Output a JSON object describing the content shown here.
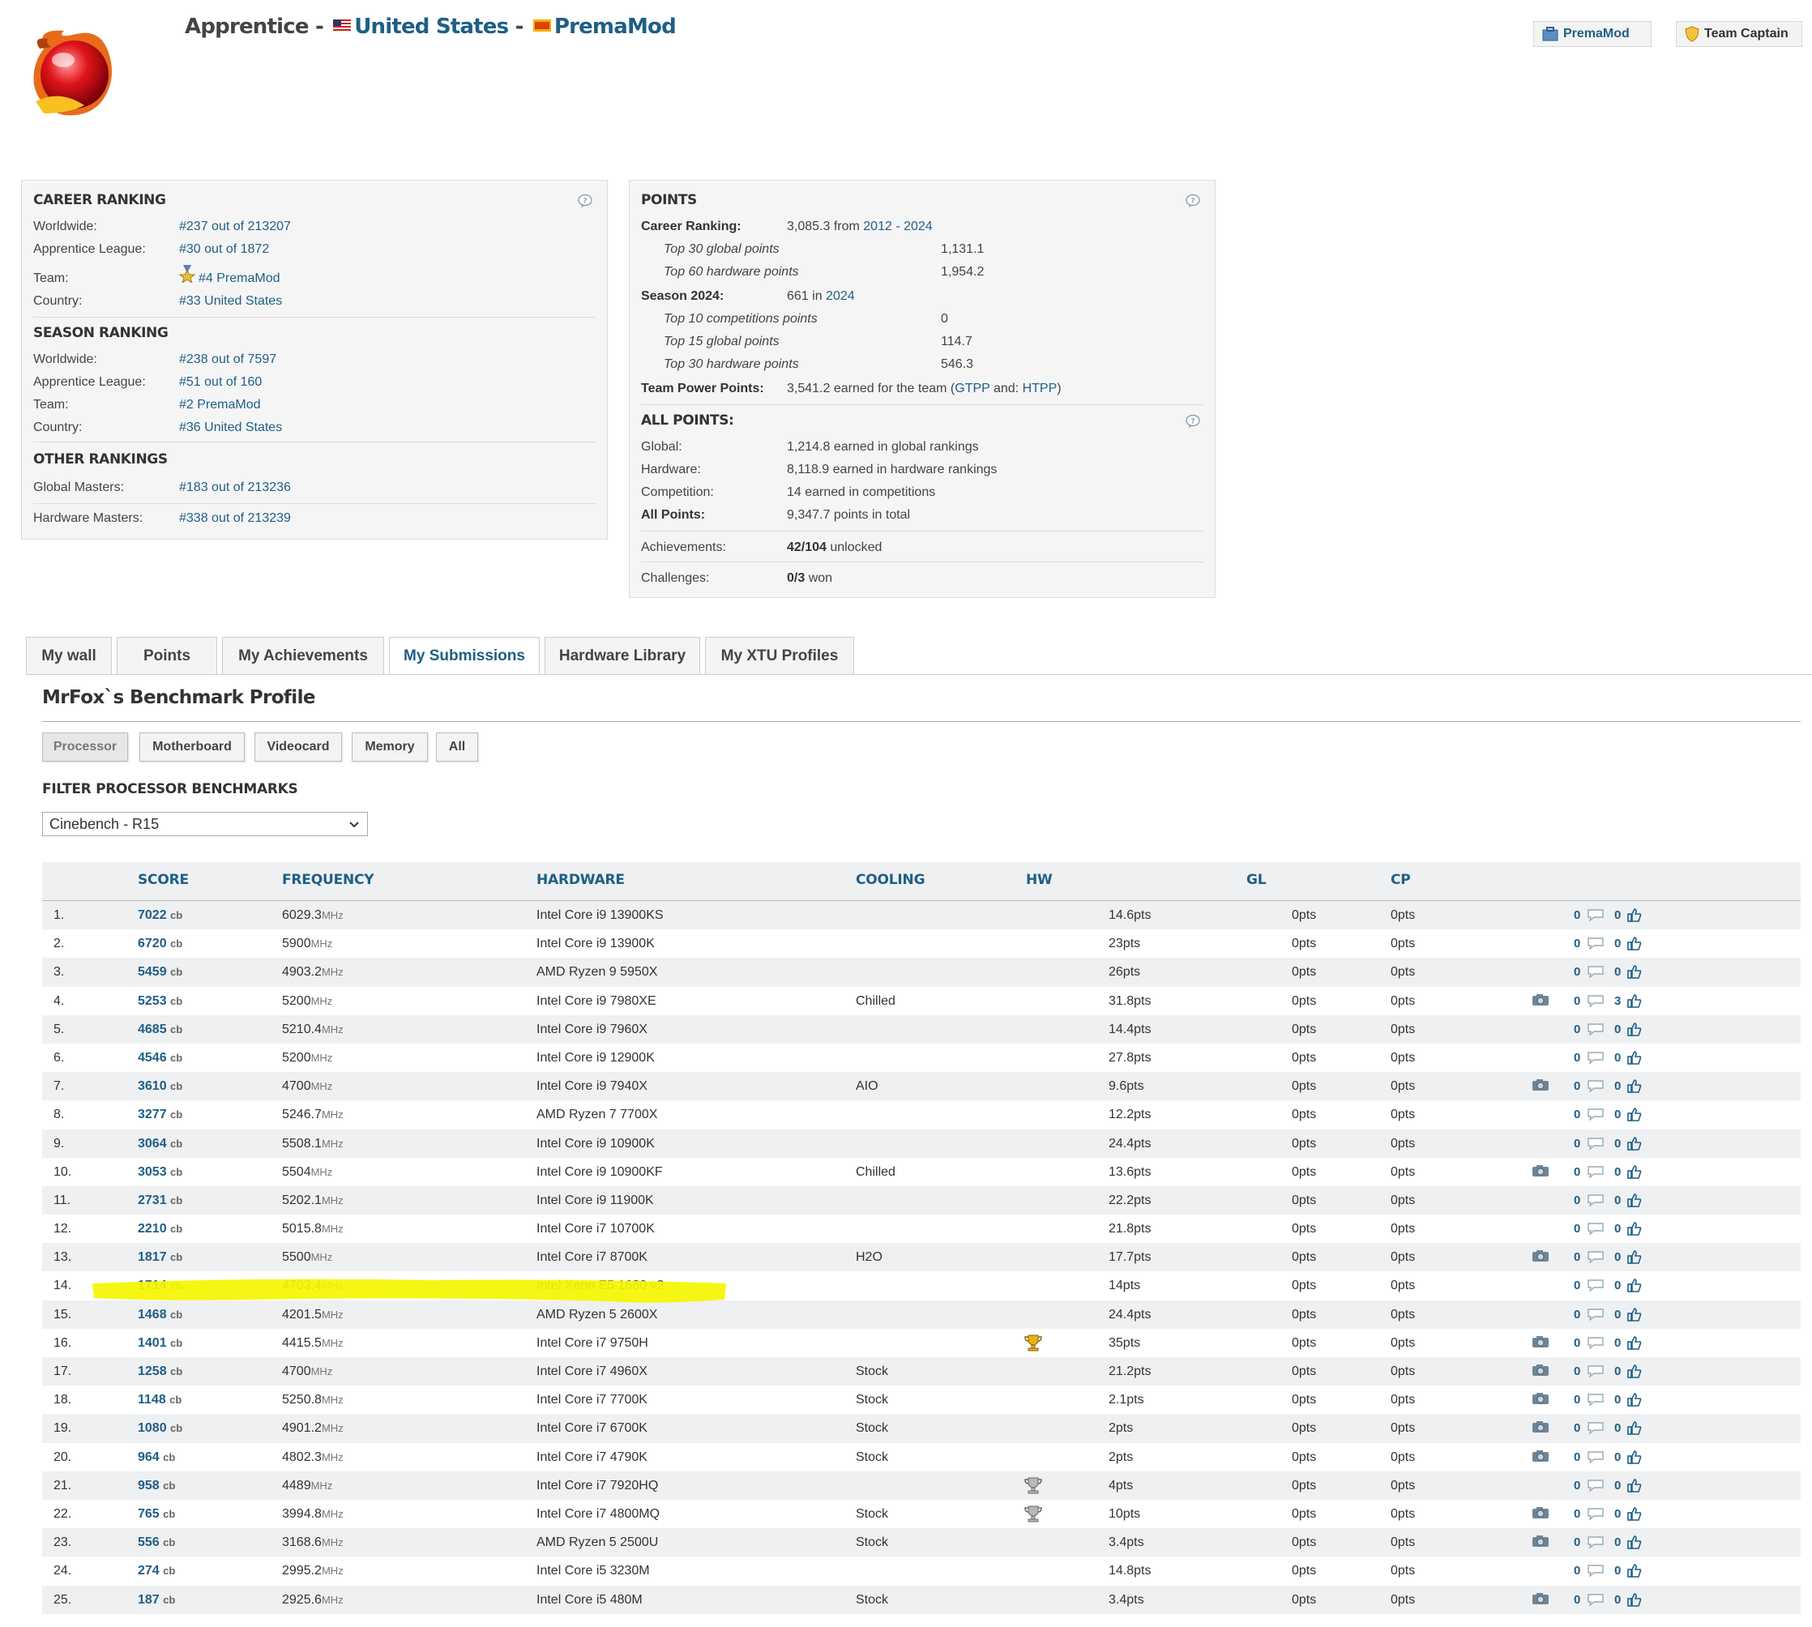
{
  "header": {
    "rank_title": "Apprentice",
    "country": "United States",
    "team": "PremaMod",
    "badge_team": "PremaMod",
    "badge_captain": "Team Captain",
    "separator": " - "
  },
  "career_ranking": {
    "title": "CAREER RANKING",
    "rows": [
      {
        "label": "Worldwide:",
        "value": "#237 out of 213207"
      },
      {
        "label": "Apprentice League:",
        "value": "#30 out of 1872"
      },
      {
        "label": "Team:",
        "value": "#4 PremaMod"
      },
      {
        "label": "Country:",
        "value": "#33 United States"
      }
    ]
  },
  "season_ranking": {
    "title": "SEASON RANKING",
    "rows": [
      {
        "label": "Worldwide:",
        "value": "#238 out of 7597"
      },
      {
        "label": "Apprentice League:",
        "value": "#51 out of 160"
      },
      {
        "label": "Team:",
        "value": "#2 PremaMod"
      },
      {
        "label": "Country:",
        "value": "#36 United States"
      }
    ]
  },
  "other_rankings": {
    "title": "OTHER RANKINGS",
    "rows": [
      {
        "label": "Global Masters:",
        "value": "#183 out of 213236"
      },
      {
        "label": "Hardware Masters:",
        "value": "#338 out of 213239"
      }
    ]
  },
  "points": {
    "title": "POINTS",
    "career_label": "Career Ranking:",
    "career_value": "3,085.3 from",
    "career_years": "2012 - 2024",
    "career_sub": [
      {
        "label": "Top 30 global points",
        "value": "1,131.1"
      },
      {
        "label": "Top 60 hardware points",
        "value": "1,954.2"
      }
    ],
    "season_label": "Season 2024:",
    "season_value": "661 in",
    "season_year": "2024",
    "season_sub": [
      {
        "label": "Top 10 competitions points",
        "value": "0"
      },
      {
        "label": "Top 15 global points",
        "value": "114.7"
      },
      {
        "label": "Top 30 hardware points",
        "value": "546.3"
      }
    ],
    "team_power_label": "Team Power Points:",
    "team_power_value": "3,541.2 earned for the team (",
    "gtpp": "GTPP",
    "and": " and: ",
    "htpp": "HTPP",
    "close": ")"
  },
  "all_points": {
    "title": "ALL POINTS:",
    "rows": [
      {
        "label": "Global:",
        "value": "1,214.8 earned in global rankings"
      },
      {
        "label": "Hardware:",
        "value": "8,118.9 earned in hardware rankings"
      },
      {
        "label": "Competition:",
        "value": "14 earned in competitions"
      }
    ],
    "total_label": "All Points:",
    "total_value": "9,347.7 points in total",
    "achievements_label": "Achievements:",
    "achievements_bold": "42/104",
    "achievements_rest": " unlocked",
    "challenges_label": "Challenges:",
    "challenges_bold": "0/3",
    "challenges_rest": " won"
  },
  "tabs": [
    "My wall",
    "Points",
    "My Achievements",
    "My Submissions",
    "Hardware Library",
    "My XTU Profiles"
  ],
  "active_tab": "My Submissions",
  "profile_title": "MrFox`s Benchmark Profile",
  "filter_tabs": [
    "Processor",
    "Motherboard",
    "Videocard",
    "Memory",
    "All"
  ],
  "active_filter_tab": "Processor",
  "filter_label": "FILTER PROCESSOR BENCHMARKS",
  "filter_value": "Cinebench - R15",
  "table": {
    "headers": {
      "score": "SCORE",
      "frequency": "FREQUENCY",
      "hardware": "HARDWARE",
      "cooling": "COOLING",
      "hw": "HW",
      "gl": "GL",
      "cp": "CP"
    },
    "score_unit": "cb",
    "freq_unit": "MHz",
    "rows": [
      {
        "rank": "1.",
        "score": "7022",
        "freq": "6029.3",
        "hw": "Intel Core i9 13900KS",
        "cooling": "",
        "trophy": "",
        "hwp": "14.6pts",
        "gl": "0pts",
        "cp": "0pts",
        "photo": false,
        "comments": "0",
        "likes": "0"
      },
      {
        "rank": "2.",
        "score": "6720",
        "freq": "5900",
        "hw": "Intel Core i9 13900K",
        "cooling": "",
        "trophy": "",
        "hwp": "23pts",
        "gl": "0pts",
        "cp": "0pts",
        "photo": false,
        "comments": "0",
        "likes": "0"
      },
      {
        "rank": "3.",
        "score": "5459",
        "freq": "4903.2",
        "hw": "AMD Ryzen 9 5950X",
        "cooling": "",
        "trophy": "",
        "hwp": "26pts",
        "gl": "0pts",
        "cp": "0pts",
        "photo": false,
        "comments": "0",
        "likes": "0"
      },
      {
        "rank": "4.",
        "score": "5253",
        "freq": "5200",
        "hw": "Intel Core i9 7980XE",
        "cooling": "Chilled",
        "trophy": "",
        "hwp": "31.8pts",
        "gl": "0pts",
        "cp": "0pts",
        "photo": true,
        "comments": "0",
        "likes": "3"
      },
      {
        "rank": "5.",
        "score": "4685",
        "freq": "5210.4",
        "hw": "Intel Core i9 7960X",
        "cooling": "",
        "trophy": "",
        "hwp": "14.4pts",
        "gl": "0pts",
        "cp": "0pts",
        "photo": false,
        "comments": "0",
        "likes": "0"
      },
      {
        "rank": "6.",
        "score": "4546",
        "freq": "5200",
        "hw": "Intel Core i9 12900K",
        "cooling": "",
        "trophy": "",
        "hwp": "27.8pts",
        "gl": "0pts",
        "cp": "0pts",
        "photo": false,
        "comments": "0",
        "likes": "0"
      },
      {
        "rank": "7.",
        "score": "3610",
        "freq": "4700",
        "hw": "Intel Core i9 7940X",
        "cooling": "AIO",
        "trophy": "",
        "hwp": "9.6pts",
        "gl": "0pts",
        "cp": "0pts",
        "photo": true,
        "comments": "0",
        "likes": "0"
      },
      {
        "rank": "8.",
        "score": "3277",
        "freq": "5246.7",
        "hw": "AMD Ryzen 7 7700X",
        "cooling": "",
        "trophy": "",
        "hwp": "12.2pts",
        "gl": "0pts",
        "cp": "0pts",
        "photo": false,
        "comments": "0",
        "likes": "0"
      },
      {
        "rank": "9.",
        "score": "3064",
        "freq": "5508.1",
        "hw": "Intel Core i9 10900K",
        "cooling": "",
        "trophy": "",
        "hwp": "24.4pts",
        "gl": "0pts",
        "cp": "0pts",
        "photo": false,
        "comments": "0",
        "likes": "0"
      },
      {
        "rank": "10.",
        "score": "3053",
        "freq": "5504",
        "hw": "Intel Core i9 10900KF",
        "cooling": "Chilled",
        "trophy": "",
        "hwp": "13.6pts",
        "gl": "0pts",
        "cp": "0pts",
        "photo": true,
        "comments": "0",
        "likes": "0"
      },
      {
        "rank": "11.",
        "score": "2731",
        "freq": "5202.1",
        "hw": "Intel Core i9 11900K",
        "cooling": "",
        "trophy": "",
        "hwp": "22.2pts",
        "gl": "0pts",
        "cp": "0pts",
        "photo": false,
        "comments": "0",
        "likes": "0"
      },
      {
        "rank": "12.",
        "score": "2210",
        "freq": "5015.8",
        "hw": "Intel Core i7 10700K",
        "cooling": "",
        "trophy": "",
        "hwp": "21.8pts",
        "gl": "0pts",
        "cp": "0pts",
        "photo": false,
        "comments": "0",
        "likes": "0"
      },
      {
        "rank": "13.",
        "score": "1817",
        "freq": "5500",
        "hw": "Intel Core i7 8700K",
        "cooling": "H2O",
        "trophy": "",
        "hwp": "17.7pts",
        "gl": "0pts",
        "cp": "0pts",
        "photo": true,
        "comments": "0",
        "likes": "0"
      },
      {
        "rank": "14.",
        "score": "1714",
        "freq": "4703.4",
        "hw": "Intel Xeon E5 1680 v2",
        "cooling": "",
        "trophy": "",
        "hwp": "14pts",
        "gl": "0pts",
        "cp": "0pts",
        "photo": false,
        "comments": "0",
        "likes": "0"
      },
      {
        "rank": "15.",
        "score": "1468",
        "freq": "4201.5",
        "hw": "AMD Ryzen 5 2600X",
        "cooling": "",
        "trophy": "",
        "hwp": "24.4pts",
        "gl": "0pts",
        "cp": "0pts",
        "photo": false,
        "comments": "0",
        "likes": "0"
      },
      {
        "rank": "16.",
        "score": "1401",
        "freq": "4415.5",
        "hw": "Intel Core i7 9750H",
        "cooling": "",
        "trophy": "gold",
        "hwp": "35pts",
        "gl": "0pts",
        "cp": "0pts",
        "photo": true,
        "comments": "0",
        "likes": "0"
      },
      {
        "rank": "17.",
        "score": "1258",
        "freq": "4700",
        "hw": "Intel Core i7 4960X",
        "cooling": "Stock",
        "trophy": "",
        "hwp": "21.2pts",
        "gl": "0pts",
        "cp": "0pts",
        "photo": true,
        "comments": "0",
        "likes": "0"
      },
      {
        "rank": "18.",
        "score": "1148",
        "freq": "5250.8",
        "hw": "Intel Core i7 7700K",
        "cooling": "Stock",
        "trophy": "",
        "hwp": "2.1pts",
        "gl": "0pts",
        "cp": "0pts",
        "photo": true,
        "comments": "0",
        "likes": "0"
      },
      {
        "rank": "19.",
        "score": "1080",
        "freq": "4901.2",
        "hw": "Intel Core i7 6700K",
        "cooling": "Stock",
        "trophy": "",
        "hwp": "2pts",
        "gl": "0pts",
        "cp": "0pts",
        "photo": true,
        "comments": "0",
        "likes": "0"
      },
      {
        "rank": "20.",
        "score": "964",
        "freq": "4802.3",
        "hw": "Intel Core i7 4790K",
        "cooling": "Stock",
        "trophy": "",
        "hwp": "2pts",
        "gl": "0pts",
        "cp": "0pts",
        "photo": true,
        "comments": "0",
        "likes": "0"
      },
      {
        "rank": "21.",
        "score": "958",
        "freq": "4489",
        "hw": "Intel Core i7 7920HQ",
        "cooling": "",
        "trophy": "silver",
        "hwp": "4pts",
        "gl": "0pts",
        "cp": "0pts",
        "photo": false,
        "comments": "0",
        "likes": "0"
      },
      {
        "rank": "22.",
        "score": "765",
        "freq": "3994.8",
        "hw": "Intel Core i7 4800MQ",
        "cooling": "Stock",
        "trophy": "silver",
        "hwp": "10pts",
        "gl": "0pts",
        "cp": "0pts",
        "photo": true,
        "comments": "0",
        "likes": "0"
      },
      {
        "rank": "23.",
        "score": "556",
        "freq": "3168.6",
        "hw": "AMD Ryzen 5 2500U",
        "cooling": "Stock",
        "trophy": "",
        "hwp": "3.4pts",
        "gl": "0pts",
        "cp": "0pts",
        "photo": true,
        "comments": "0",
        "likes": "0"
      },
      {
        "rank": "24.",
        "score": "274",
        "freq": "2995.2",
        "hw": "Intel Core i5 3230M",
        "cooling": "",
        "trophy": "",
        "hwp": "14.8pts",
        "gl": "0pts",
        "cp": "0pts",
        "photo": false,
        "comments": "0",
        "likes": "0"
      },
      {
        "rank": "25.",
        "score": "187",
        "freq": "2925.6",
        "hw": "Intel Core i5 480M",
        "cooling": "Stock",
        "trophy": "",
        "hwp": "3.4pts",
        "gl": "0pts",
        "cp": "0pts",
        "photo": true,
        "comments": "0",
        "likes": "0"
      }
    ]
  },
  "colors": {
    "link": "#1f5f85",
    "highlight": "#f5f500",
    "panel_bg": "#f5f5f5"
  }
}
